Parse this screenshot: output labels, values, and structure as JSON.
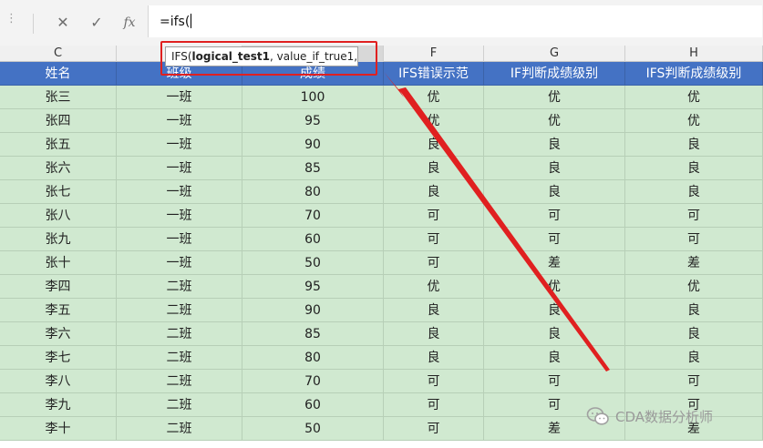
{
  "formula_bar": {
    "more_icon": "⋮",
    "cancel_icon": "✕",
    "enter_icon": "✓",
    "fx_label": "fx",
    "formula_text": "=ifs("
  },
  "columns": [
    "C",
    "",
    "",
    "F",
    "G",
    "H"
  ],
  "tooltip": {
    "func": "IFS(",
    "arg1": "logical_test1",
    "rest": ", value_if_true1, ...)"
  },
  "table": {
    "headers": [
      "姓名",
      "班级",
      "成绩",
      "IFS错误示范",
      "IF判断成绩级别",
      "IFS判断成绩级别"
    ],
    "rows": [
      [
        "张三",
        "一班",
        "100",
        "优",
        "优",
        "优"
      ],
      [
        "张四",
        "一班",
        "95",
        "优",
        "优",
        "优"
      ],
      [
        "张五",
        "一班",
        "90",
        "良",
        "良",
        "良"
      ],
      [
        "张六",
        "一班",
        "85",
        "良",
        "良",
        "良"
      ],
      [
        "张七",
        "一班",
        "80",
        "良",
        "良",
        "良"
      ],
      [
        "张八",
        "一班",
        "70",
        "可",
        "可",
        "可"
      ],
      [
        "张九",
        "一班",
        "60",
        "可",
        "可",
        "可"
      ],
      [
        "张十",
        "一班",
        "50",
        "可",
        "差",
        "差"
      ],
      [
        "李四",
        "二班",
        "95",
        "优",
        "优",
        "优"
      ],
      [
        "李五",
        "二班",
        "90",
        "良",
        "良",
        "良"
      ],
      [
        "李六",
        "二班",
        "85",
        "良",
        "良",
        "良"
      ],
      [
        "李七",
        "二班",
        "80",
        "良",
        "良",
        "良"
      ],
      [
        "李八",
        "二班",
        "70",
        "可",
        "可",
        "可"
      ],
      [
        "李九",
        "二班",
        "60",
        "可",
        "可",
        "可"
      ],
      [
        "李十",
        "二班",
        "50",
        "可",
        "差",
        "差"
      ]
    ]
  },
  "watermark": {
    "text": "CDA数据分析师",
    "icon": "wechat-icon"
  },
  "colors": {
    "header_bg": "#4472c4",
    "cell_bg": "#d0e9d0",
    "highlight": "#e02020"
  }
}
